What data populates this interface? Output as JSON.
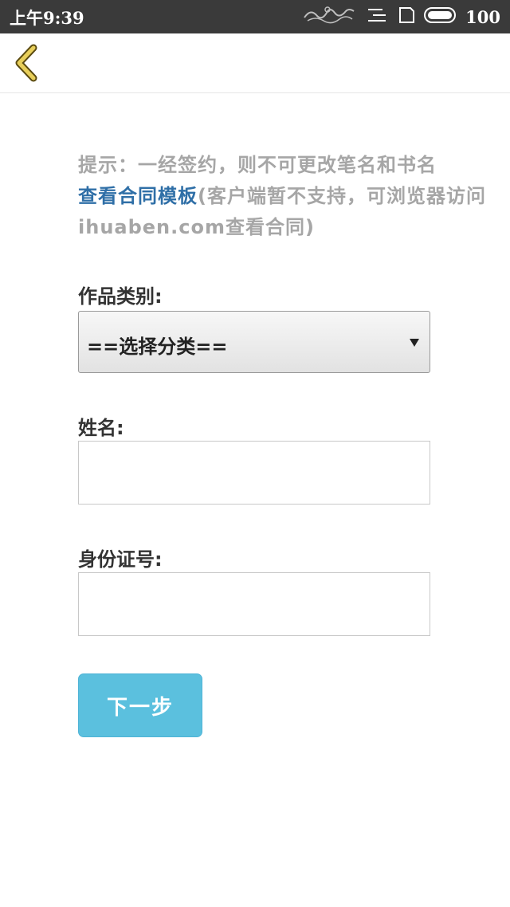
{
  "status_bar": {
    "time": "上午9:39",
    "battery": "100",
    "icons": [
      "notification-icon",
      "signal-icon",
      "sim-icon",
      "battery-icon"
    ]
  },
  "header": {
    "back_icon": "chevron-left-icon",
    "back_color": "#e8cf5a"
  },
  "notice": {
    "prefix": "提示：一经签约，则不可更改笔名和书名",
    "link": "查看合同模板",
    "suffix": "(客户端暂不支持，可浏览器访问ihuaben.com查看合同)"
  },
  "form": {
    "category_label": "作品类别:",
    "category_value": "==选择分类==",
    "name_label": "姓名:",
    "name_value": "",
    "id_label": "身份证号:",
    "id_value": "",
    "next_label": "下一步"
  },
  "colors": {
    "status_bar": "#3a3a3a",
    "link": "#2f6fa7",
    "button": "#5bc0de",
    "hint_text": "#a6a6a6"
  }
}
